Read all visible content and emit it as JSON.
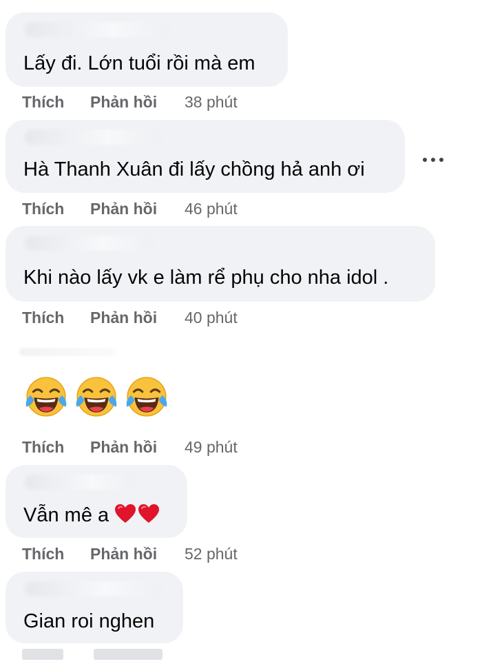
{
  "comments": [
    {
      "text": "Lấy đi. Lớn tuổi rồi mà em",
      "like": "Thích",
      "reply": "Phản hồi",
      "time": "38 phút"
    },
    {
      "text": "Hà Thanh Xuân đi lấy chồng hả anh ơi",
      "like": "Thích",
      "reply": "Phản hồi",
      "time": "46 phút"
    },
    {
      "text": "Khi nào lấy vk e làm rể phụ cho nha idol .",
      "like": "Thích",
      "reply": "Phản hồi",
      "time": "40 phút"
    },
    {
      "emojis": [
        "face-with-tears-of-joy",
        "face-with-tears-of-joy",
        "face-with-tears-of-joy"
      ],
      "like": "Thích",
      "reply": "Phản hồi",
      "time": "49 phút"
    },
    {
      "text": "Vẫn mê a",
      "emojis": [
        "red-heart",
        "red-heart"
      ],
      "like": "Thích",
      "reply": "Phản hồi",
      "time": "52 phút"
    },
    {
      "text": "Gian roi nghen"
    }
  ],
  "colors": {
    "bubble": "#f0f2f5",
    "meta": "#65676b",
    "text": "#050505",
    "heart": "#e0142b",
    "emoji_face": "#f9c23c"
  }
}
